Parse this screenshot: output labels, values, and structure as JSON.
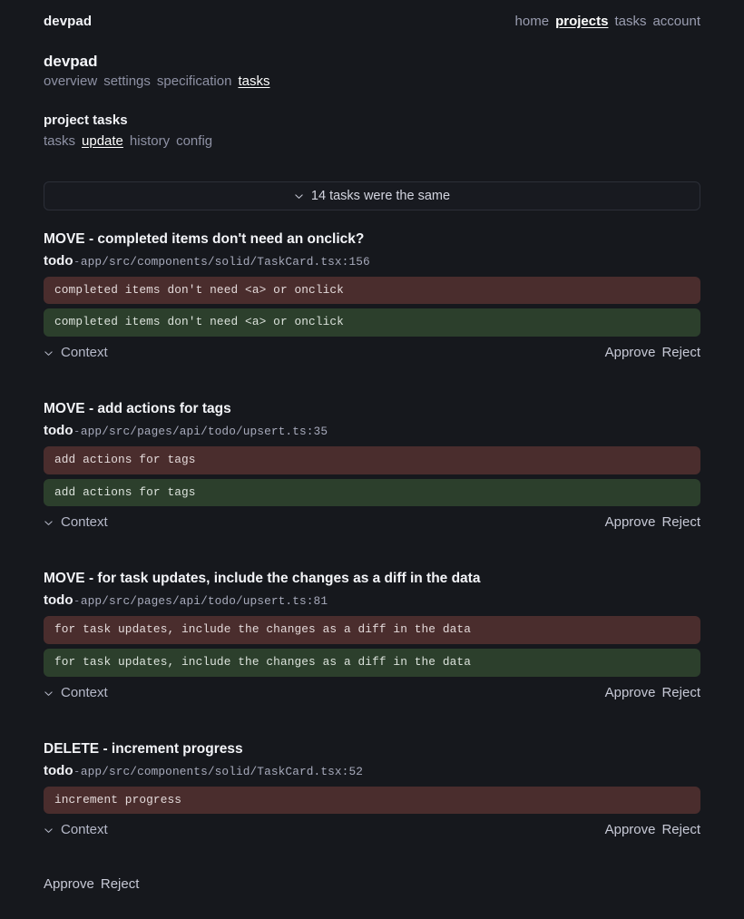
{
  "app": {
    "brand": "devpad",
    "background_color": "#16181d"
  },
  "topnav": {
    "items": [
      {
        "label": "home",
        "active": false
      },
      {
        "label": "projects",
        "active": true
      },
      {
        "label": "tasks",
        "active": false
      },
      {
        "label": "account",
        "active": false
      }
    ]
  },
  "project": {
    "title": "devpad",
    "subnav": [
      {
        "label": "overview",
        "active": false
      },
      {
        "label": "settings",
        "active": false
      },
      {
        "label": "specification",
        "active": false
      },
      {
        "label": "tasks",
        "active": true
      }
    ]
  },
  "section": {
    "title": "project tasks",
    "tabs": [
      {
        "label": "tasks",
        "active": false
      },
      {
        "label": "update",
        "active": true
      },
      {
        "label": "history",
        "active": false
      },
      {
        "label": "config",
        "active": false
      }
    ]
  },
  "same_banner": {
    "icon": "chevron-down-icon",
    "label": "14 tasks were the same",
    "count": 14
  },
  "labels": {
    "context": "Context",
    "approve": "Approve",
    "reject": "Reject",
    "context_icon": "chevron-down-icon"
  },
  "colors": {
    "diff_removed_bg": "#4a2d2d",
    "diff_added_bg": "#2c3f2c",
    "banner_bg": "#181a20",
    "banner_border": "#2c2f38",
    "muted_text": "#8e91a4",
    "accent_text": "#ffffff"
  },
  "tasks": [
    {
      "title": "MOVE - completed items don't need an onclick?",
      "tag": "todo",
      "separator": "-",
      "path": "app/src/components/solid/TaskCard.tsx:156",
      "diffs": [
        {
          "kind": "removed",
          "text": "completed items don't need <a> or onclick"
        },
        {
          "kind": "added",
          "text": "completed items don't need <a> or onclick"
        }
      ]
    },
    {
      "title": "MOVE - add actions for tags",
      "tag": "todo",
      "separator": "-",
      "path": "app/src/pages/api/todo/upsert.ts:35",
      "diffs": [
        {
          "kind": "removed",
          "text": "add actions for tags"
        },
        {
          "kind": "added",
          "text": "add actions for tags"
        }
      ]
    },
    {
      "title": "MOVE - for task updates, include the changes as a diff in the data",
      "tag": "todo",
      "separator": "-",
      "path": "app/src/pages/api/todo/upsert.ts:81",
      "diffs": [
        {
          "kind": "removed",
          "text": "for task updates, include the changes as a diff in the data"
        },
        {
          "kind": "added",
          "text": "for task updates, include the changes as a diff in the data"
        }
      ]
    },
    {
      "title": "DELETE - increment progress",
      "tag": "todo",
      "separator": "-",
      "path": "app/src/components/solid/TaskCard.tsx:52",
      "diffs": [
        {
          "kind": "removed",
          "text": "increment progress"
        }
      ]
    }
  ],
  "page_actions": {
    "approve": "Approve",
    "reject": "Reject"
  }
}
